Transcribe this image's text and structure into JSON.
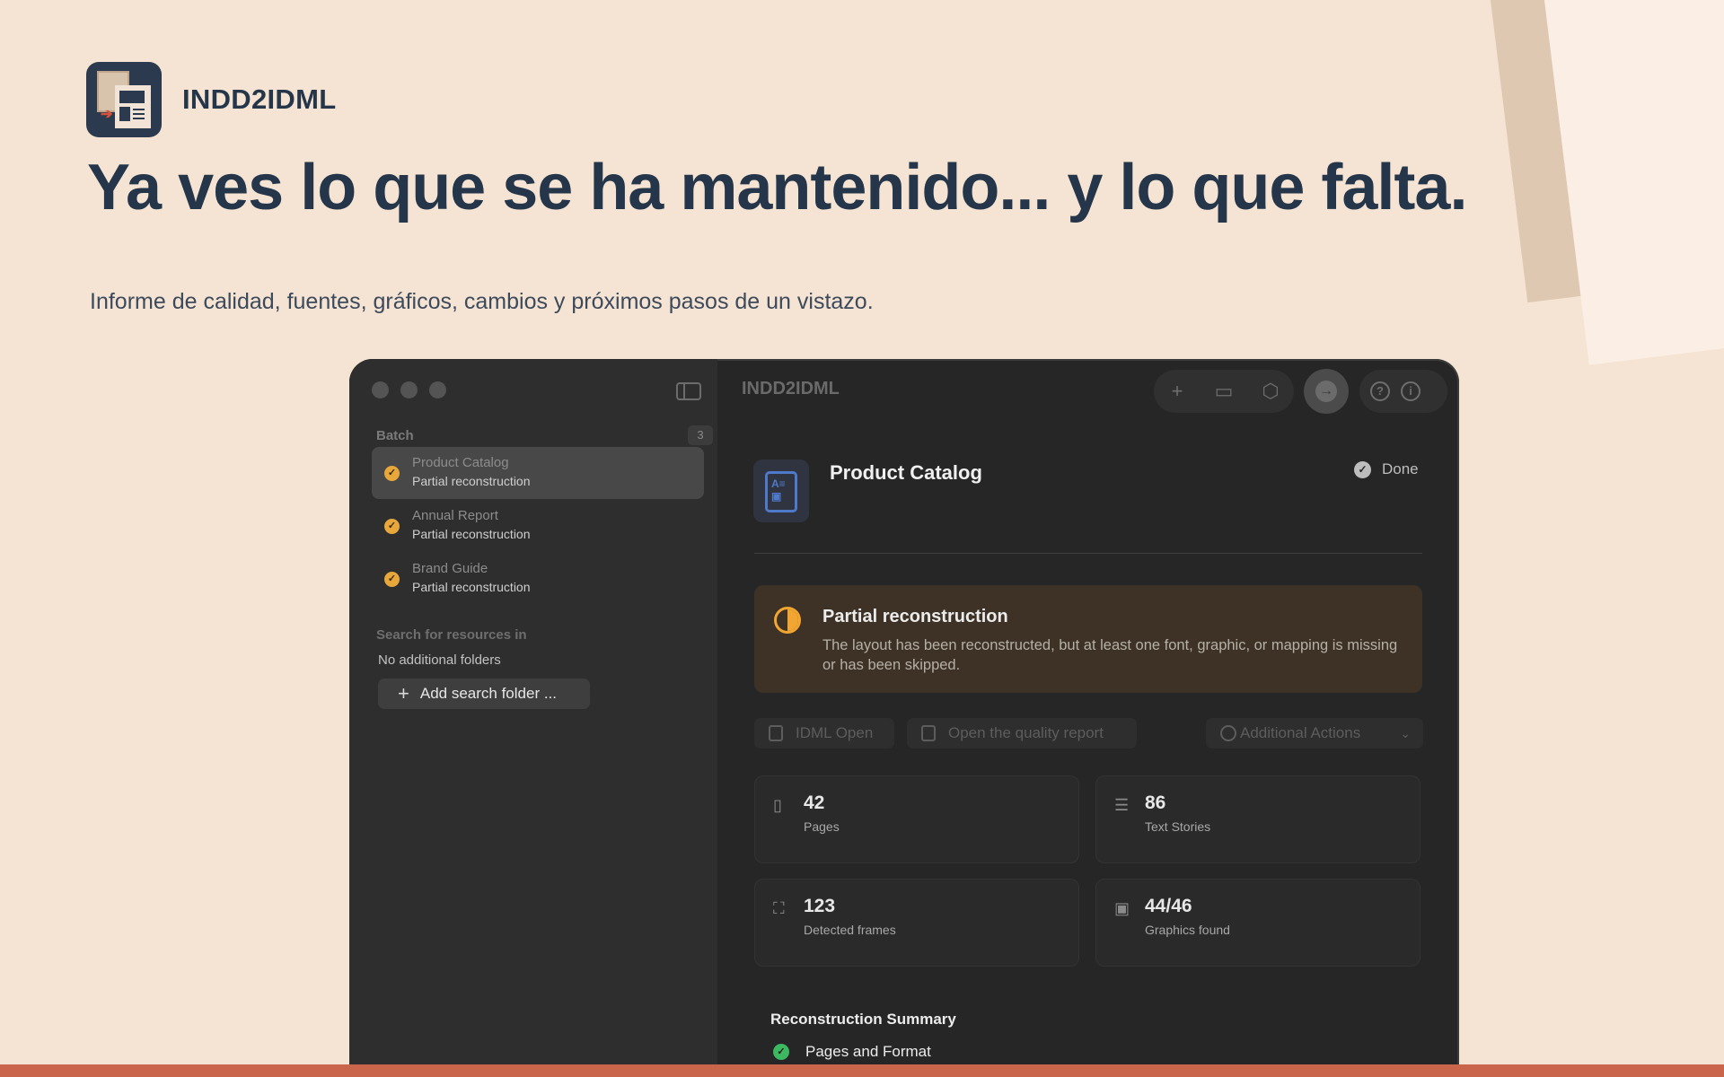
{
  "brand": {
    "name": "INDD2IDML"
  },
  "hero": {
    "headline": "Ya ves lo que se ha mantenido... y lo que falta.",
    "subtitle": "Informe de calidad, fuentes, gráficos, cambios y próximos pasos de un vistazo."
  },
  "window": {
    "title": "INDD2IDML",
    "toolbar_icons": [
      "plus-icon",
      "folder-icon",
      "package-icon",
      "convert-icon",
      "help-icon",
      "info-icon"
    ]
  },
  "sidebar": {
    "batch_label": "Batch",
    "batch_count": "3",
    "items": [
      {
        "title": "Product Catalog",
        "status": "Partial reconstruction"
      },
      {
        "title": "Annual Report",
        "status": "Partial reconstruction"
      },
      {
        "title": "Brand Guide",
        "status": "Partial reconstruction"
      }
    ],
    "search_label": "Search for resources in",
    "no_folders": "No additional folders",
    "add_folder_label": "Add search folder ..."
  },
  "detail": {
    "title": "Product Catalog",
    "status": "Done",
    "banner": {
      "title": "Partial reconstruction",
      "text": "The layout has been reconstructed, but at least one font, graphic, or mapping is missing or has been skipped."
    },
    "actions": {
      "idml_open": "IDML Open",
      "quality_report": "Open the quality report",
      "additional": "Additional Actions"
    },
    "stats": [
      {
        "value": "42",
        "label": "Pages"
      },
      {
        "value": "86",
        "label": "Text Stories"
      },
      {
        "value": "123",
        "label": "Detected frames"
      },
      {
        "value": "44/46",
        "label": "Graphics found"
      }
    ],
    "summary_title": "Reconstruction Summary",
    "summary_items": [
      {
        "label": "Pages and Format"
      }
    ]
  },
  "colors": {
    "background": "#f5e4d3",
    "headline": "#26364a",
    "accent_bar": "#c9654a",
    "warning": "#f2a631",
    "success": "#3cb860"
  }
}
